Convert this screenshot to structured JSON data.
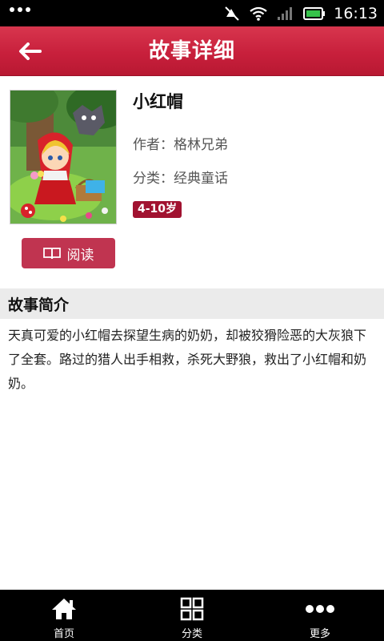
{
  "status_bar": {
    "time": "16:13"
  },
  "header": {
    "title": "故事详细",
    "back_icon": "back-arrow-icon"
  },
  "book": {
    "title": "小红帽",
    "author": "作者：格林兄弟",
    "category": "分类：经典童话",
    "age_range": "4-10岁",
    "read_label": "阅读"
  },
  "summary": {
    "heading": "故事简介",
    "text": "天真可爱的小红帽去探望生病的奶奶，却被狡猾险恶的大灰狼下了全套。路过的猎人出手相救，杀死大野狼，救出了小红帽和奶奶。"
  },
  "bottom_nav": {
    "items": [
      {
        "label": "首页",
        "icon": "home-icon"
      },
      {
        "label": "分类",
        "icon": "grid-icon"
      },
      {
        "label": "更多",
        "icon": "more-dots-icon"
      }
    ]
  },
  "colors": {
    "brand": "#c8203c",
    "badge": "#a11230",
    "button": "#c03450"
  }
}
